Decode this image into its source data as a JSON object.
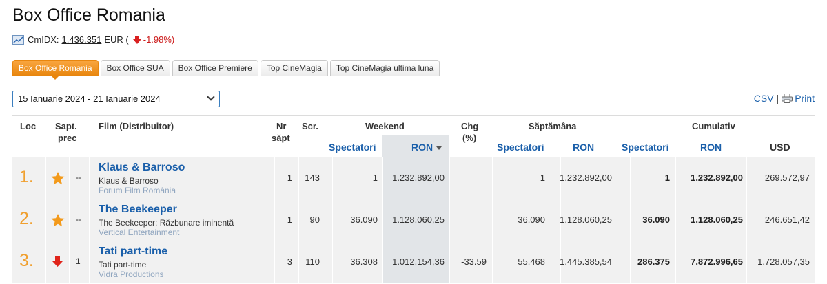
{
  "page_title": "Box Office Romania",
  "cmidx": {
    "label": "CmIDX:",
    "value": "1.436.351",
    "currency": "EUR (",
    "change": "-1.98%)",
    "icon": "chart-icon",
    "change_icon": "down-arrow-icon"
  },
  "tabs": [
    {
      "label": "Box Office Romania",
      "active": true
    },
    {
      "label": "Box Office SUA",
      "active": false
    },
    {
      "label": "Box Office Premiere",
      "active": false
    },
    {
      "label": "Top CineMagia",
      "active": false
    },
    {
      "label": "Top CineMagia ultima luna",
      "active": false
    }
  ],
  "date_select": {
    "selected": "15 Ianuarie 2024 - 21 Ianuarie 2024"
  },
  "export": {
    "csv": "CSV",
    "separator": "|",
    "print": "Print"
  },
  "table": {
    "headers": {
      "loc": "Loc",
      "sapt_prec_1": "Sapt.",
      "sapt_prec_2": "prec",
      "film": "Film (Distribuitor)",
      "nr_1": "Nr",
      "nr_2": "săpt",
      "scr": "Scr.",
      "weekend": "Weekend",
      "chg_1": "Chg",
      "chg_2": "(%)",
      "saptamana": "Săptămâna",
      "cumulativ": "Cumulativ",
      "weekend_spectatori": "Spectatori",
      "weekend_ron": "RON",
      "saptamana_spectatori": "Spectatori",
      "saptamana_ron": "RON",
      "cum_spectatori": "Spectatori",
      "cum_ron": "RON",
      "cum_usd": "USD"
    },
    "rows": [
      {
        "rank": "1.",
        "trend": "new",
        "prev": "--",
        "title": "Klaus & Barroso",
        "original": "Klaus & Barroso",
        "distributor": "Forum Film România",
        "weeks": "1",
        "screens": "143",
        "wk_spect": "1",
        "wk_ron": "1.232.892,00",
        "chg": "",
        "sapt_spect": "1",
        "sapt_ron": "1.232.892,00",
        "cum_spect": "1",
        "cum_ron": "1.232.892,00",
        "cum_usd": "269.572,97"
      },
      {
        "rank": "2.",
        "trend": "new",
        "prev": "--",
        "title": "The Beekeeper",
        "original": "The Beekeeper: Răzbunare iminentă",
        "distributor": "Vertical Entertainment",
        "weeks": "1",
        "screens": "90",
        "wk_spect": "36.090",
        "wk_ron": "1.128.060,25",
        "chg": "",
        "sapt_spect": "36.090",
        "sapt_ron": "1.128.060,25",
        "cum_spect": "36.090",
        "cum_ron": "1.128.060,25",
        "cum_usd": "246.651,42"
      },
      {
        "rank": "3.",
        "trend": "down",
        "prev": "1",
        "title": "Tati part-time",
        "original": "Tati part-time",
        "distributor": "Vidra Productions",
        "weeks": "3",
        "screens": "110",
        "wk_spect": "36.308",
        "wk_ron": "1.012.154,36",
        "chg": "-33.59",
        "sapt_spect": "55.468",
        "sapt_ron": "1.445.385,54",
        "cum_spect": "286.375",
        "cum_ron": "7.872.996,65",
        "cum_usd": "1.728.057,35"
      }
    ]
  },
  "colors": {
    "accent": "#e8860e",
    "link": "#1a5faa",
    "rank": "#f0a030",
    "negative": "#cc1a1a",
    "distributor": "#8fa5bf"
  }
}
